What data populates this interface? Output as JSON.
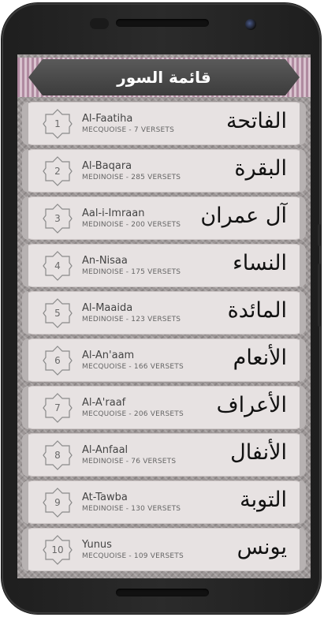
{
  "header": {
    "title": "قائمة السور"
  },
  "surahs": [
    {
      "number": "1",
      "name": "Al-Faatiha",
      "subtitle": "MECQUOISE - 7 VERSETS",
      "arabic": "الفاتحة"
    },
    {
      "number": "2",
      "name": "Al-Baqara",
      "subtitle": "MEDINOISE - 285 VERSETS",
      "arabic": "البقرة"
    },
    {
      "number": "3",
      "name": "Aal-i-Imraan",
      "subtitle": "MEDINOISE - 200 VERSETS",
      "arabic": "آل عمران"
    },
    {
      "number": "4",
      "name": "An-Nisaa",
      "subtitle": "MEDINOISE - 175 VERSETS",
      "arabic": "النساء"
    },
    {
      "number": "5",
      "name": "Al-Maaida",
      "subtitle": "MEDINOISE - 123 VERSETS",
      "arabic": "المائدة"
    },
    {
      "number": "6",
      "name": "Al-An'aam",
      "subtitle": "MECQUOISE - 166 VERSETS",
      "arabic": "الأنعام"
    },
    {
      "number": "7",
      "name": "Al-A'raaf",
      "subtitle": "MECQUOISE - 206 VERSETS",
      "arabic": "الأعراف"
    },
    {
      "number": "8",
      "name": "Al-Anfaal",
      "subtitle": "MEDINOISE - 76 VERSETS",
      "arabic": "الأنفال"
    },
    {
      "number": "9",
      "name": "At-Tawba",
      "subtitle": "MEDINOISE - 130 VERSETS",
      "arabic": "التوبة"
    },
    {
      "number": "10",
      "name": "Yunus",
      "subtitle": "MECQUOISE - 109 VERSETS",
      "arabic": "يونس"
    }
  ],
  "colors": {
    "header_plate": "#4a4a4a",
    "row_bg": "#e7e2e2",
    "frame": "#9d9797"
  }
}
